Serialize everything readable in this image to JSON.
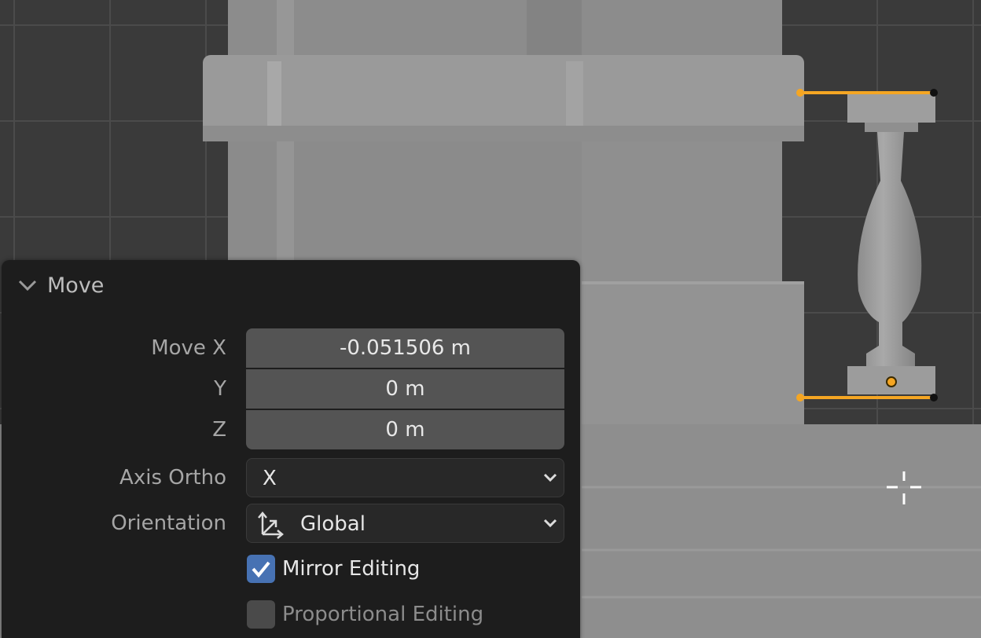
{
  "panel": {
    "title": "Move",
    "fields": {
      "move_x": {
        "label": "Move X",
        "value": "-0.051506 m"
      },
      "y": {
        "label": "Y",
        "value": "0 m"
      },
      "z": {
        "label": "Z",
        "value": "0 m"
      }
    },
    "axis_ortho": {
      "label": "Axis Ortho",
      "value": "X"
    },
    "orientation": {
      "label": "Orientation",
      "value": "Global"
    },
    "mirror_editing": {
      "label": "Mirror Editing",
      "checked": true
    },
    "proportional_editing": {
      "label": "Proportional Editing",
      "checked": false
    }
  },
  "colors": {
    "accent_blue": "#4772b3",
    "selection_orange": "#f5a623",
    "panel_bg": "#1d1d1d",
    "field_bg": "#545454",
    "viewport_bg": "#3a3a3a"
  },
  "icons": {
    "collapse": "chevron-down-icon",
    "dropdown": "dropdown-arrow-icon",
    "orientation": "orientation-global-icon",
    "cursor": "3d-cursor-icon",
    "checkmark": "checkmark-icon"
  }
}
